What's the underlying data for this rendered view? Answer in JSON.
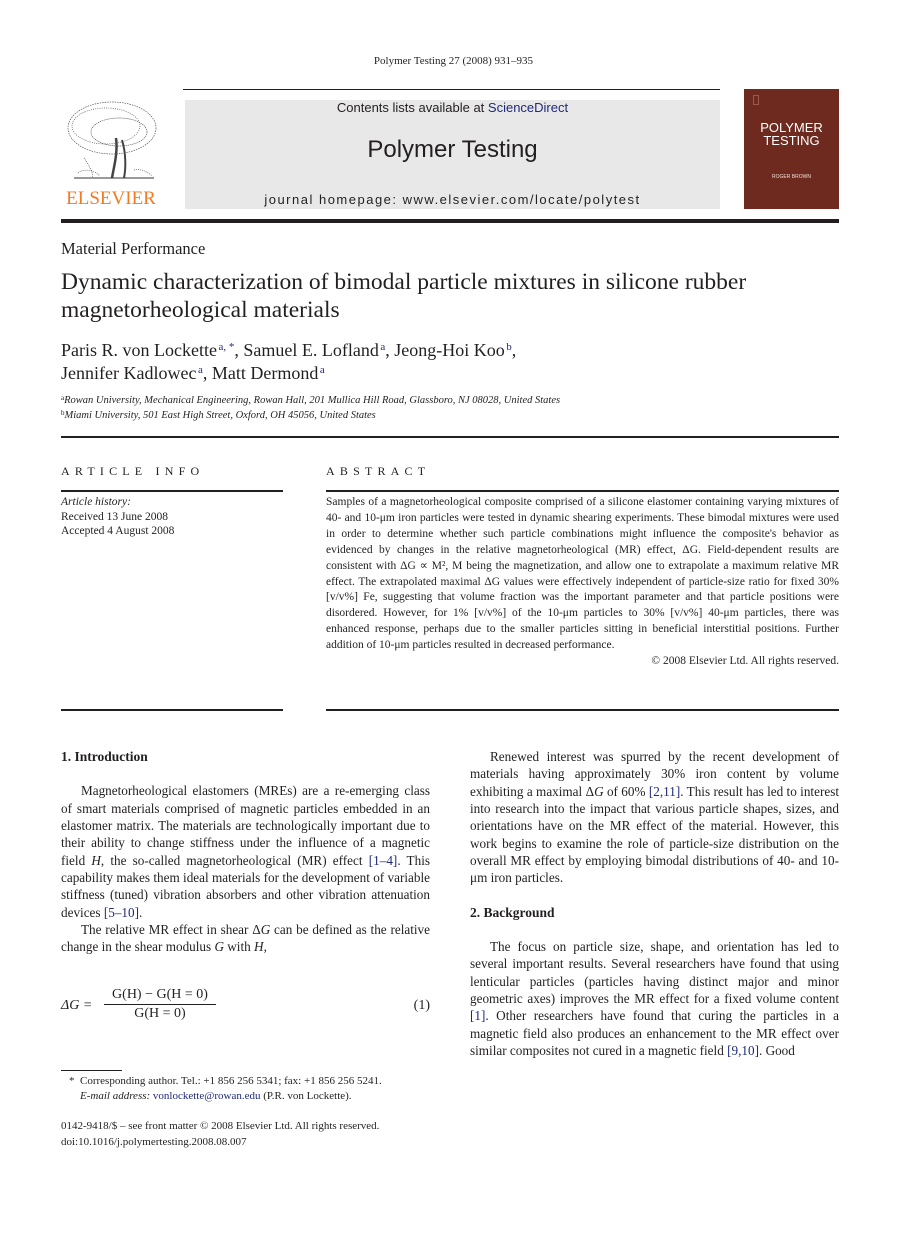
{
  "running_head": "Polymer Testing 27 (2008) 931–935",
  "masthead": {
    "publisher_wordmark": "ELSEVIER",
    "contents_prefix": "Contents lists available at ",
    "contents_link": "ScienceDirect",
    "journal_title": "Polymer Testing",
    "homepage": "journal homepage: www.elsevier.com/locate/polytest",
    "cover": {
      "title_line1": "POLYMER",
      "title_line2": "TESTING",
      "editor": "ROGER BROWN",
      "color": "#6e2a1e"
    },
    "wordmark_color": "#f47a20",
    "banner_color": "#e8e8e8"
  },
  "article": {
    "section": "Material Performance",
    "title_line1": "Dynamic characterization of bimodal particle mixtures in silicone rubber",
    "title_line2": "magnetorheological materials",
    "authors": [
      {
        "name": "Paris R. von Lockette",
        "sup": "a, *",
        "sep": ", "
      },
      {
        "name": "Samuel E. Lofland",
        "sup": "a",
        "sep": ", "
      },
      {
        "name": "Jeong-Hoi Koo",
        "sup": "b",
        "sep": ","
      },
      {
        "name": "Jennifer Kadlowec",
        "sup": "a",
        "sep": ", "
      },
      {
        "name": "Matt Dermond",
        "sup": "a",
        "sep": ""
      }
    ],
    "affiliations": [
      {
        "key": "a",
        "text": "Rowan University, Mechanical Engineering, Rowan Hall, 201 Mullica Hill Road, Glassboro, NJ 08028, United States"
      },
      {
        "key": "b",
        "text": "Miami University, 501 East High Street, Oxford, OH 45056, United States"
      }
    ]
  },
  "article_info": {
    "heading": "ARTICLE INFO",
    "history_label": "Article history:",
    "received": "Received 13 June 2008",
    "accepted": "Accepted 4 August 2008"
  },
  "abstract": {
    "heading": "ABSTRACT",
    "text": "Samples of a magnetorheological composite comprised of a silicone elastomer containing varying mixtures of 40- and 10-μm iron particles were tested in dynamic shearing experiments. These bimodal mixtures were used in order to determine whether such particle combinations might influence the composite's behavior as evidenced by changes in the relative magnetorheological (MR) effect, ΔG. Field-dependent results are consistent with ΔG ∝ M², M being the magnetization, and allow one to extrapolate a maximum relative MR effect. The extrapolated maximal ΔG values were effectively independent of particle-size ratio for fixed 30% [v/v%] Fe, suggesting that volume fraction was the important parameter and that particle positions were disordered. However, for 1% [v/v%] of the 10-μm particles to 30% [v/v%] 40-μm particles, there was enhanced response, perhaps due to the smaller particles sitting in beneficial interstitial positions. Further addition of 10-μm particles resulted in decreased performance.",
    "copyright": "© 2008 Elsevier Ltd. All rights reserved."
  },
  "body": {
    "intro_heading": "1.  Introduction",
    "intro_p1_a": "Magnetorheological elastomers (MREs) are a re-emerging class of smart materials comprised of magnetic particles embedded in an elastomer matrix. The materials are technologically important due to their ability to change stiffness under the influence of a magnetic field ",
    "intro_p1_H": "H",
    "intro_p1_b": ", the so-called magnetorheological (MR) effect ",
    "intro_p1_ref1": "[1–4]",
    "intro_p1_c": ". This capability makes them ideal materials for the development of variable stiffness (tuned) vibration absorbers and other vibration attenuation devices ",
    "intro_p1_ref2": "[5–10]",
    "intro_p1_d": ".",
    "intro_p2_a": "The relative MR effect in shear Δ",
    "intro_p2_G": "G",
    "intro_p2_b": " can be defined as the relative change in the shear modulus ",
    "intro_p2_G2": "G",
    "intro_p2_c": " with ",
    "intro_p2_H": "H",
    "intro_p2_d": ",",
    "equation": {
      "lhs": "ΔG =",
      "numerator": "G(H) − G(H = 0)",
      "denominator": "G(H = 0)",
      "number": "(1)"
    },
    "right_p1_a": "Renewed interest was spurred by the recent development of materials having approximately 30% iron content by volume exhibiting a maximal Δ",
    "right_p1_G": "G",
    "right_p1_b": " of 60% ",
    "right_p1_ref": "[2,11]",
    "right_p1_c": ". This result has led to interest into research into the impact that various particle shapes, sizes, and orientations have on the MR effect of the material. However, this work begins to examine the role of particle-size distribution on the overall MR effect by employing bimodal distributions of 40- and 10-μm iron particles.",
    "background_heading": "2.  Background",
    "bg_p1_a": "The focus on particle size, shape, and orientation has led to several important results. Several researchers have found that using lenticular particles (particles having distinct major and minor geometric axes) improves the MR effect for a fixed volume content ",
    "bg_p1_ref1": "[1]",
    "bg_p1_b": ". Other researchers have found that curing the particles in a magnetic field also produces an enhancement to the MR effect over similar composites not cured in a magnetic field ",
    "bg_p1_ref2": "[9,10]",
    "bg_p1_c": ". Good"
  },
  "footnote": {
    "marker": "*",
    "line1": "Corresponding author. Tel.: +1 856 256 5341; fax: +1 856 256 5241.",
    "email_label": "E-mail address:",
    "email": "vonlockette@rowan.edu",
    "email_suffix": " (P.R. von Lockette)."
  },
  "front_matter": {
    "issn": "0142-9418/$ – see front matter © 2008 Elsevier Ltd. All rights reserved.",
    "doi": "doi:10.1016/j.polymertesting.2008.08.007"
  }
}
